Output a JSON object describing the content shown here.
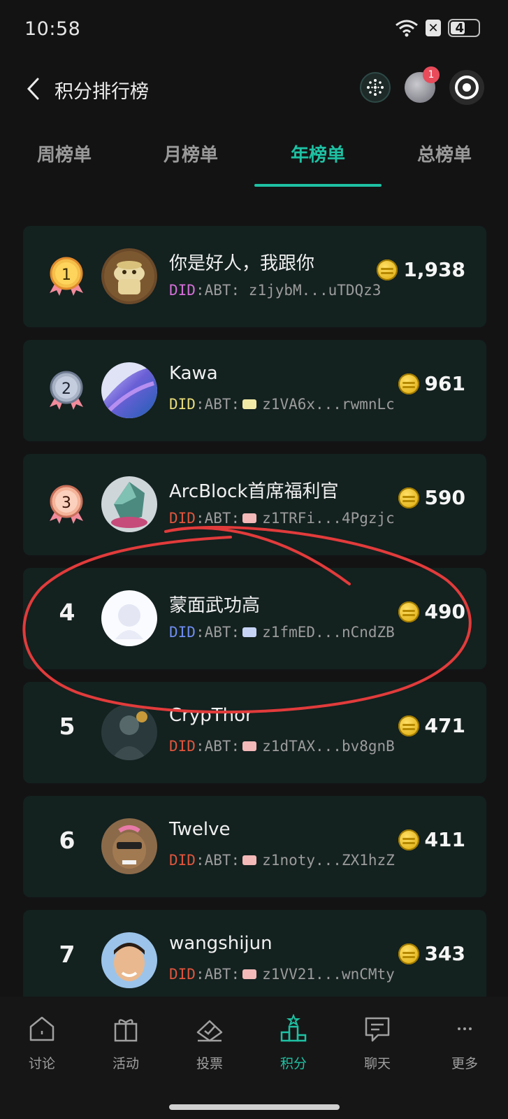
{
  "status_bar": {
    "time": "10:58",
    "battery": "47"
  },
  "header": {
    "title": "积分排行榜",
    "notification_count": "1"
  },
  "tabs": [
    {
      "label": "周榜单",
      "active": false
    },
    {
      "label": "月榜单",
      "active": false
    },
    {
      "label": "年榜单",
      "active": true
    },
    {
      "label": "总榜单",
      "active": false
    }
  ],
  "ranking": [
    {
      "rank": "1",
      "name": "你是好人，我跟你",
      "did_prefix": "DID",
      "did_text": ":ABT: z1jybM...uTDQz3",
      "score": "1,938",
      "prefix_color": "#d46fd8",
      "chip_color": "",
      "medal": "gold"
    },
    {
      "rank": "2",
      "name": "Kawa",
      "did_prefix": "DID",
      "did_text": ":ABT:",
      "did_addr": "z1VA6x...rwmnLc",
      "score": "961",
      "prefix_color": "#e8dc7a",
      "chip_color": "#f1e9a6",
      "medal": "silver"
    },
    {
      "rank": "3",
      "name": "ArcBlock首席福利官",
      "did_prefix": "DID",
      "did_text": ":ABT:",
      "did_addr": "z1TRFi...4Pgzjc",
      "score": "590",
      "prefix_color": "#e0553d",
      "chip_color": "#f3b8b8",
      "medal": "bronze"
    },
    {
      "rank": "4",
      "name": "蒙面武功高",
      "did_prefix": "DID",
      "did_text": ":ABT:",
      "did_addr": "z1fmED...nCndZB",
      "score": "490",
      "prefix_color": "#6f8df0",
      "chip_color": "#c7d3f5",
      "medal": ""
    },
    {
      "rank": "5",
      "name": "CrypThor",
      "did_prefix": "DID",
      "did_text": ":ABT:",
      "did_addr": "z1dTAX...bv8gnB",
      "score": "471",
      "prefix_color": "#e0553d",
      "chip_color": "#f3b8b8",
      "medal": ""
    },
    {
      "rank": "6",
      "name": "Twelve",
      "did_prefix": "DID",
      "did_text": ":ABT:",
      "did_addr": "z1noty...ZX1hzZ",
      "score": "411",
      "prefix_color": "#e0553d",
      "chip_color": "#f3b8b8",
      "medal": ""
    },
    {
      "rank": "7",
      "name": "wangshijun",
      "did_prefix": "DID",
      "did_text": ":ABT:",
      "did_addr": "z1VV21...wnCMty",
      "score": "343",
      "prefix_color": "#e0553d",
      "chip_color": "#f3b8b8",
      "medal": ""
    }
  ],
  "bottom_nav": [
    {
      "label": "讨论",
      "icon": "home-icon",
      "active": false
    },
    {
      "label": "活动",
      "icon": "gift-icon",
      "active": false
    },
    {
      "label": "投票",
      "icon": "vote-icon",
      "active": false
    },
    {
      "label": "积分",
      "icon": "podium-icon",
      "active": true
    },
    {
      "label": "聊天",
      "icon": "chat-icon",
      "active": false
    },
    {
      "label": "更多",
      "icon": "more-icon",
      "active": false
    }
  ],
  "colors": {
    "accent": "#1ec1a3",
    "card_bg": "#13211f",
    "page_bg": "#131314",
    "annotation": "#e23b3b"
  }
}
